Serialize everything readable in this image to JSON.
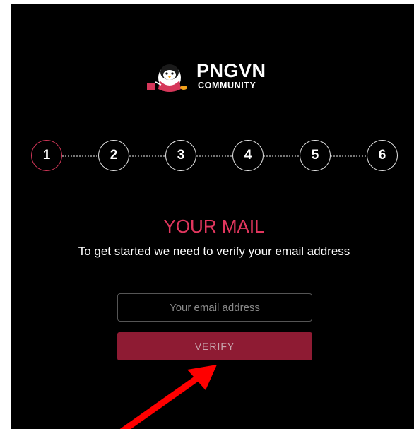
{
  "brand": {
    "name": "PNGVN",
    "subtitle": "COMMUNITY",
    "logo_icon": "penguin-mascot-icon"
  },
  "steps": [
    "1",
    "2",
    "3",
    "4",
    "5",
    "6"
  ],
  "active_step": 1,
  "heading": "YOUR MAIL",
  "subtitle": "To get started we need to verify your email address",
  "email": {
    "placeholder": "Your email address",
    "value": ""
  },
  "verify_label": "VERIFY",
  "colors": {
    "accent": "#e0365e",
    "button": "#8e1b33",
    "panel": "#000000",
    "annotation_arrow": "#ff0000"
  }
}
